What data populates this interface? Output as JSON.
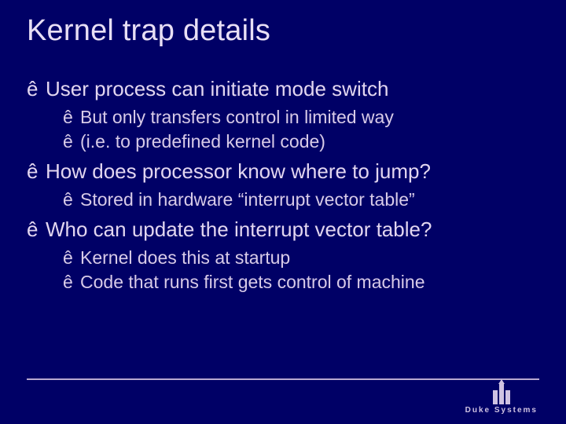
{
  "title": "Kernel trap details",
  "bullets": [
    {
      "text": "User process can initiate mode switch",
      "children": [
        "But only transfers control in limited way",
        "(i.e. to predefined kernel code)"
      ]
    },
    {
      "text": "How does processor know where to jump?",
      "children": [
        "Stored in hardware “interrupt vector table”"
      ]
    },
    {
      "text": "Who can update the interrupt vector table?",
      "children": [
        "Kernel does this at startup",
        "Code that runs first gets control of machine"
      ]
    }
  ],
  "footer": {
    "brand": "Duke Systems"
  }
}
